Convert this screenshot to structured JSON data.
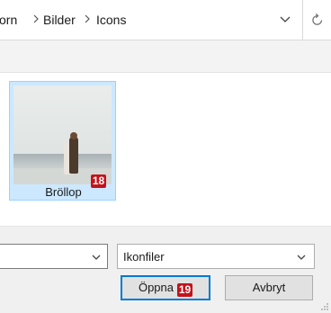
{
  "breadcrumb": {
    "items": [
      "orn",
      "Bilder",
      "Icons"
    ]
  },
  "file": {
    "name": "Bröllop",
    "badge": "18"
  },
  "filetype": {
    "selected": "Ikonfiler"
  },
  "buttons": {
    "open": "Öppna",
    "open_badge": "19",
    "cancel": "Avbryt"
  },
  "icons": {
    "separator": "chevron-right-icon",
    "address_dropdown": "chevron-down-icon",
    "refresh": "refresh-icon"
  },
  "colors": {
    "selection": "#cce8ff",
    "selection_border": "#99d1ff",
    "badge": "#c4121b",
    "default_button_border": "#0078d7"
  }
}
